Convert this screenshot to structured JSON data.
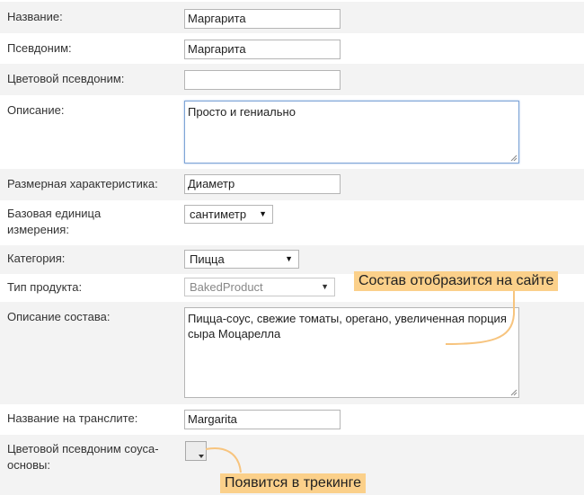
{
  "form": {
    "name": {
      "label": "Название:",
      "value": "Маргарита"
    },
    "alias": {
      "label": "Псевдоним:",
      "value": "Маргарита"
    },
    "color_alias": {
      "label": "Цветовой псевдоним:",
      "value": ""
    },
    "description": {
      "label": "Описание:",
      "value": "Просто и гениально"
    },
    "size_characteristic": {
      "label": "Размерная характеристика:",
      "value": "Диаметр"
    },
    "base_unit": {
      "label": "Базовая единица измерения:",
      "value": "сантиметр"
    },
    "category": {
      "label": "Категория:",
      "value": "Пицца"
    },
    "product_type": {
      "label": "Тип продукта:",
      "value": "BakedProduct"
    },
    "composition": {
      "label": "Описание состава:",
      "value": "Пицца-соус, свежие томаты, орегано, увеличенная порция сыра Моцарелла"
    },
    "translit_name": {
      "label": "Название на транслите:",
      "value": "Margarita"
    },
    "sauce_color_alias": {
      "label": "Цветовой псевдоним соуса-основы:"
    }
  },
  "callouts": {
    "composition_note": "Состав отобразится на сайте",
    "tracking_note": "Появится в трекинге"
  },
  "colors": {
    "row_alt": "#f3f3f3",
    "callout_bg": "#fbd08a",
    "callout_line": "#f7c47e",
    "focus_border": "#7ea4d6"
  },
  "icons": {
    "dropdown": "triangle-down",
    "resize": "resize-grip"
  }
}
